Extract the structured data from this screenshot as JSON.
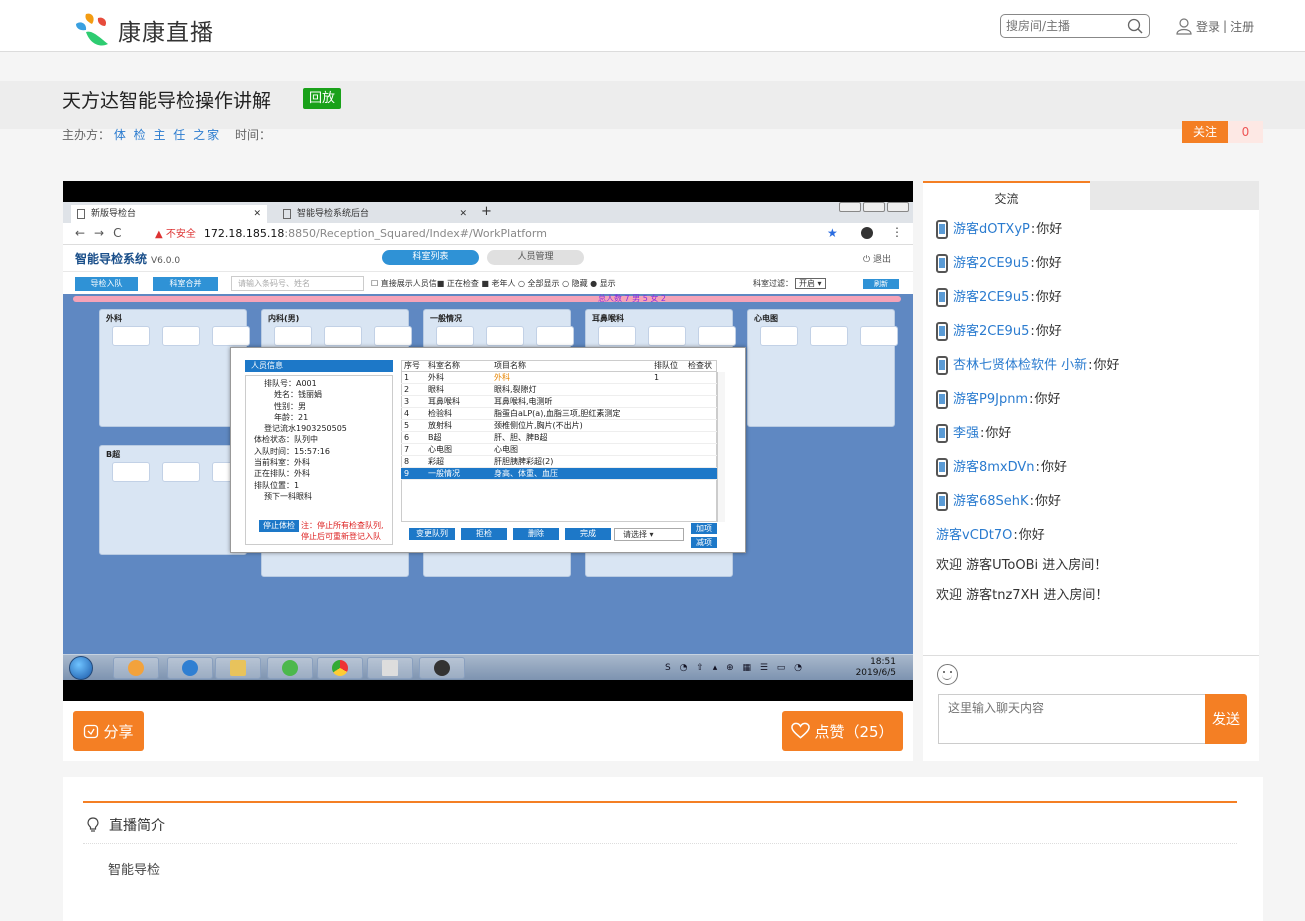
{
  "header": {
    "brand": "康康直播",
    "search_placeholder": "搜房间/主播",
    "login_label": "登录",
    "separator": "|",
    "register_label": "注册"
  },
  "room": {
    "title": "天方达智能导检操作讲解",
    "status_badge": "回放",
    "host_label": "主办方：",
    "host_name": "体 检 主 任 之家",
    "time_label": "时间：",
    "follow_label": "关注",
    "follow_count": "0"
  },
  "video": {
    "browser": {
      "tab1": "新版导检台",
      "tab2": "智能导检系统后台",
      "warning": "▲ 不安全",
      "url_host": "172.18.185.18",
      "url_rest": ":8850/Reception_Squared/Index#/WorkPlatform"
    },
    "app": {
      "name": "智能导检系统",
      "version": "V6.0.0",
      "tab_active": "科室列表",
      "tab_inactive": "人员管理",
      "logout": "⏻ 退出",
      "btn_enqueue": "导检入队",
      "btn_merge": "科室合并",
      "search_placeholder": "请输入条码号、姓名",
      "options": "☐ 直接展示人员信■ 正在检查  ■ 老年人  ○ 全部显示  ○ 隐藏  ● 显示",
      "filter_label": "科室过滤：",
      "filter_value": "开启 ▾",
      "refresh": "刷新",
      "summary": "总人数 7 男 5  女 2",
      "cards": [
        "外科",
        "内科(男)",
        "一般情况",
        "耳鼻喉科",
        "心电图",
        "B超"
      ]
    },
    "dialog": {
      "left_title": "人员信息",
      "info_lines": [
        "排队号：A001",
        "姓名：钱丽娟",
        "性别：男",
        "年龄：21",
        "登记流水1903250505",
        "体检状态：队列中",
        "入队时间：15:57:16",
        "当前科室：外科",
        "正在排队：外科",
        "排队位置：1",
        "预下一科眼科"
      ],
      "stop_label": "停止体检",
      "note": "注：停止所有检查队列,停止后可重新登记入队",
      "columns": [
        "序号",
        "科室名称",
        "项目名称",
        "排队位",
        "检查状"
      ],
      "rows": [
        [
          "1",
          "外科",
          "外科",
          "1",
          ""
        ],
        [
          "2",
          "眼科",
          "眼科,裂隙灯",
          "",
          ""
        ],
        [
          "3",
          "耳鼻喉科",
          "耳鼻喉科,电测听",
          "",
          ""
        ],
        [
          "4",
          "检验科",
          "脂蛋白aLP(a),血脂三项,胆红素测定",
          "",
          ""
        ],
        [
          "5",
          "放射科",
          "颈椎侧位片,胸片(不出片)",
          "",
          ""
        ],
        [
          "6",
          "B超",
          "肝、胆、脾B超",
          "",
          ""
        ],
        [
          "7",
          "心电图",
          "心电图",
          "",
          ""
        ],
        [
          "8",
          "彩超",
          "肝胆胰脾彩超(2)",
          "",
          ""
        ],
        [
          "9",
          "一般情况",
          "身高、体重、血压",
          "",
          ""
        ]
      ],
      "selected_row": 8,
      "actions": [
        "变更队列",
        "拒检",
        "删除",
        "完成"
      ],
      "select_placeholder": "请选择 ▾",
      "add_label": "加项",
      "minus_label": "减项"
    },
    "taskbar": {
      "tray": "S ◔ ⇧ ▴ ⊕ ▦ ☰ ▭ ◔",
      "time": "18:51",
      "date": "2019/6/5"
    }
  },
  "actions": {
    "share_label": "分享",
    "like_label": "点赞（25）"
  },
  "chat": {
    "tab": "交流",
    "messages": [
      {
        "mobile": true,
        "user": "游客dOTXyP",
        "text": "你好"
      },
      {
        "mobile": true,
        "user": "游客2CE9u5",
        "text": "你好"
      },
      {
        "mobile": true,
        "user": "游客2CE9u5",
        "text": "你好"
      },
      {
        "mobile": true,
        "user": "游客2CE9u5",
        "text": "你好"
      },
      {
        "mobile": true,
        "user": "杏林七贤体检软件 小新",
        "text": "你好"
      },
      {
        "mobile": true,
        "user": "游客P9Jpnm",
        "text": "你好"
      },
      {
        "mobile": true,
        "user": "李强",
        "text": "你好"
      },
      {
        "mobile": true,
        "user": "游客8mxDVn",
        "text": "你好"
      },
      {
        "mobile": true,
        "user": "游客68SehK",
        "text": "你好"
      },
      {
        "mobile": false,
        "user": "游客vCDt7O",
        "text": "你好"
      }
    ],
    "system": [
      "欢迎 游客UToOBi 进入房间！",
      "欢迎 游客tnz7XH 进入房间！"
    ],
    "input_placeholder": "这里输入聊天内容",
    "send_label": "发送"
  },
  "intro": {
    "heading": "直播简介",
    "body": "智能导检"
  },
  "colors": {
    "accent": "#f47f24",
    "link": "#2a7bcf",
    "badge_green": "#1aa11a"
  }
}
